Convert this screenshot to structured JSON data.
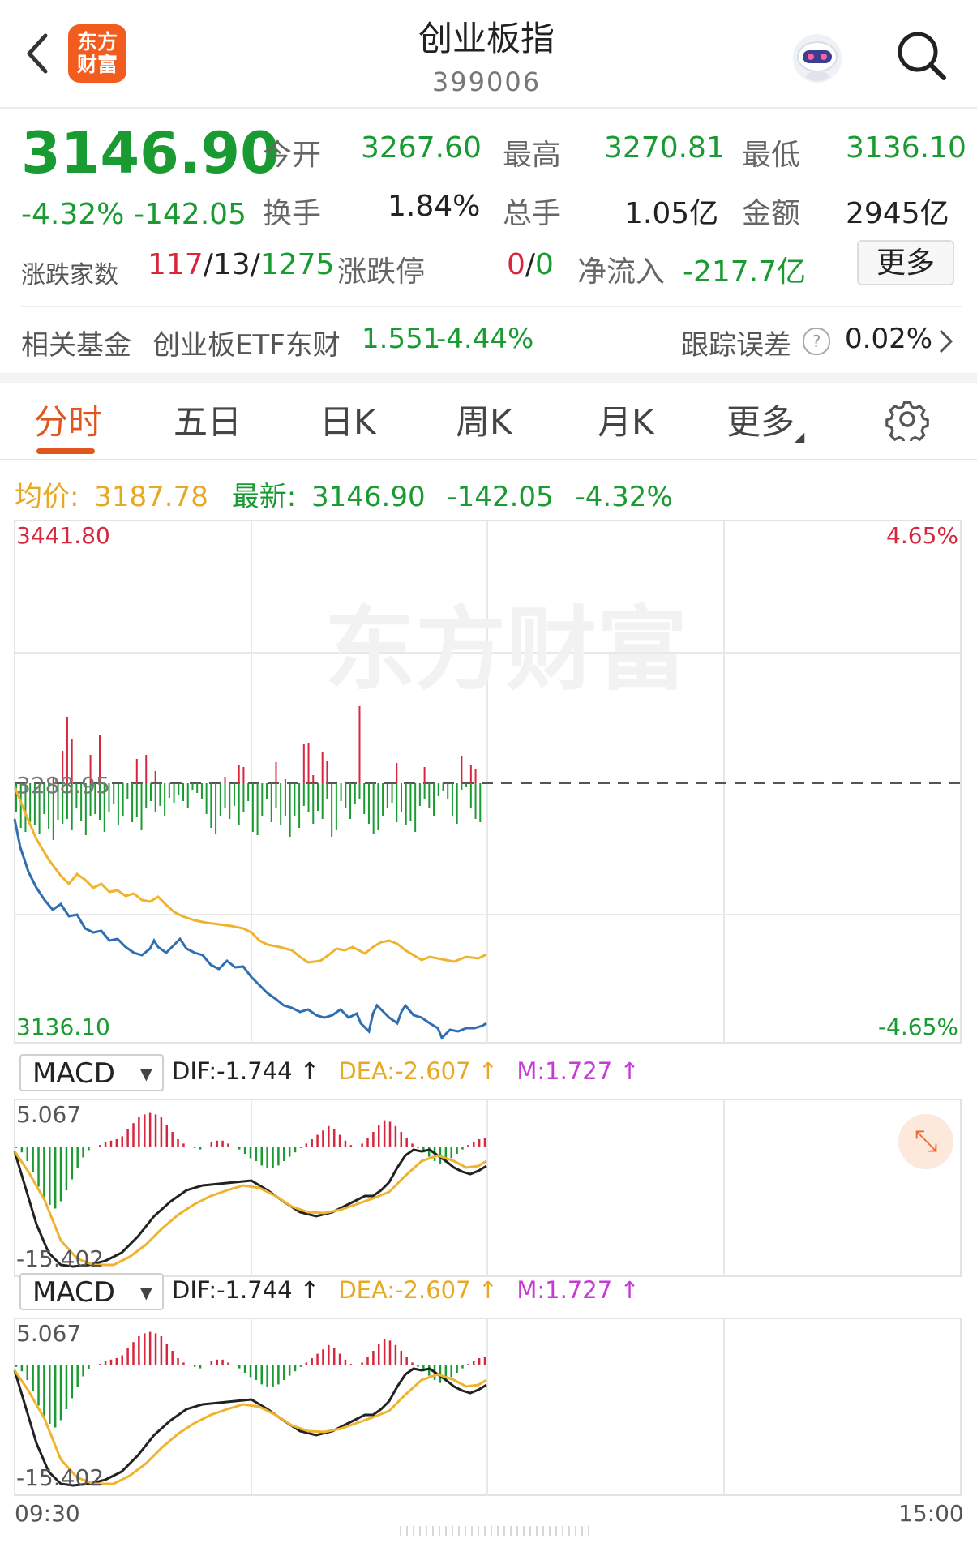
{
  "header": {
    "title": "创业板指",
    "code": "399006",
    "logo_text_1": "东方",
    "logo_text_2": "财富",
    "back_icon": "chevron-left-icon",
    "search_icon": "search-icon"
  },
  "quote": {
    "price": "3146.90",
    "change_pct": "-4.32%",
    "change_amt": "-142.05",
    "open_label": "今开",
    "open": "3267.60",
    "high_label": "最高",
    "high": "3270.81",
    "low_label": "最低",
    "low": "3136.10",
    "turnover_label": "换手",
    "turnover": "1.84%",
    "volume_label": "总手",
    "volume": "1.05亿",
    "amount_label": "金额",
    "amount": "2945亿",
    "breadth_label": "涨跌家数",
    "breadth_up": "117",
    "breadth_flat": "13",
    "breadth_down": "1275",
    "limit_label": "涨跌停",
    "limit_up": "0",
    "limit_down": "0",
    "netflow_label": "净流入",
    "netflow": "-217.7亿",
    "more_button": "更多"
  },
  "fund": {
    "label": "相关基金",
    "name": "创业板ETF东财",
    "price": "1.551",
    "change": "-4.44%",
    "tracking_label": "跟踪误差",
    "tracking_value": "0.02%"
  },
  "tabs": [
    {
      "label": "分时",
      "active": true
    },
    {
      "label": "五日"
    },
    {
      "label": "日K"
    },
    {
      "label": "周K"
    },
    {
      "label": "月K"
    },
    {
      "label": "更多"
    }
  ],
  "settings_icon": "gear-icon",
  "info_line": {
    "avg_label": "均价:",
    "avg_value": "3187.78",
    "latest_label": "最新:",
    "latest_value": "3146.90",
    "latest_change": "-142.05",
    "latest_pct": "-4.32%"
  },
  "chart_data": {
    "type": "line",
    "y_top": "3441.80",
    "y_prev_close": "3288.95",
    "y_bottom": "3136.10",
    "pct_top": "4.65%",
    "pct_bottom": "-4.65%",
    "x_start": "09:30",
    "x_end": "15:00",
    "watermark": "东方财富",
    "ylim": [
      3136.1,
      3441.8
    ],
    "prev_close": 3288.95,
    "price_series_approx": [
      3250,
      3205,
      3200,
      3195,
      3185,
      3180,
      3175,
      3170,
      3168,
      3165,
      3162,
      3160,
      3158,
      3160,
      3157,
      3150,
      3148,
      3145,
      3142,
      3143,
      3140,
      3138,
      3141,
      3139,
      3144,
      3143,
      3138,
      3140,
      3146
    ],
    "avg_series_approx": [
      3288,
      3255,
      3240,
      3235,
      3228,
      3223,
      3220,
      3216,
      3212,
      3210,
      3205,
      3200,
      3196,
      3193,
      3190,
      3188,
      3185,
      3182,
      3180,
      3183,
      3180,
      3186,
      3189,
      3187,
      3185,
      3185,
      3182,
      3183,
      3187
    ],
    "colors": {
      "price": "#2f6eb3",
      "avg": "#f0b32e",
      "up": "#d7263d",
      "down": "#1a9b32"
    }
  },
  "macd_panels": [
    {
      "selector": "MACD",
      "dif_label": "DIF:-1.744",
      "dea_label": "DEA:-2.607",
      "m_label": "M:1.727",
      "arrow": "↑",
      "y_top": "5.067",
      "y_bottom": "-15.402"
    },
    {
      "selector": "MACD",
      "dif_label": "DIF:-1.744",
      "dea_label": "DEA:-2.607",
      "m_label": "M:1.727",
      "arrow": "↑",
      "y_top": "5.067",
      "y_bottom": "-15.402"
    }
  ]
}
